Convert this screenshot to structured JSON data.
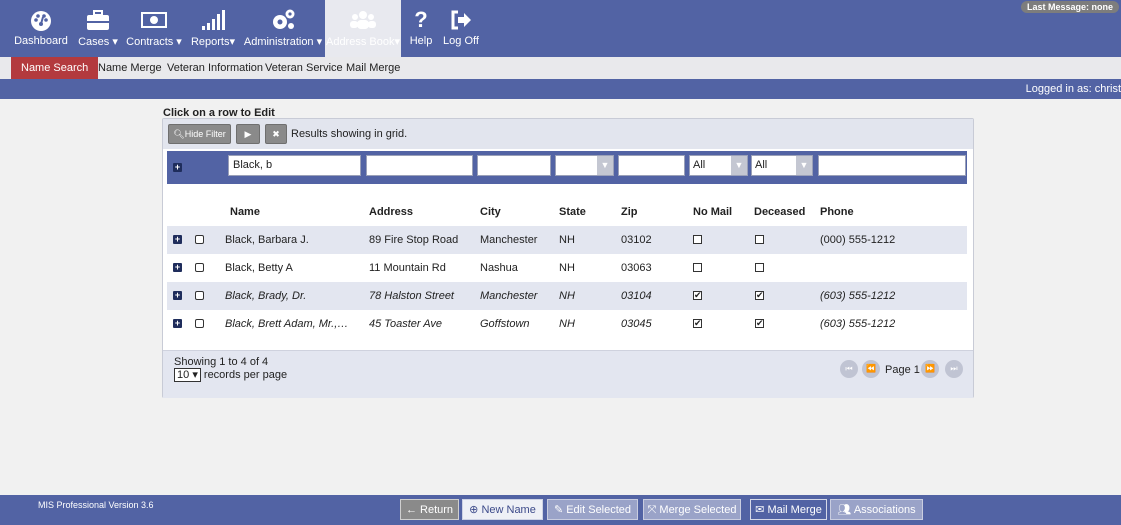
{
  "nav": {
    "items": [
      {
        "label": "Dashboard",
        "icon": "dashboard-icon"
      },
      {
        "label": "Cases",
        "icon": "briefcase-icon"
      },
      {
        "label": "Contracts",
        "icon": "money-icon"
      },
      {
        "label": "Reports",
        "icon": "bar-chart-icon"
      },
      {
        "label": "Administration",
        "icon": "gears-icon"
      },
      {
        "label": "Address Book",
        "icon": "users-icon"
      },
      {
        "label": "Help",
        "icon": "question-icon"
      },
      {
        "label": "Log Off",
        "icon": "logoff-icon"
      }
    ],
    "last_message": "Last Message: none"
  },
  "subnav": {
    "items": [
      "Name Search",
      "Name Merge",
      "Veteran Information",
      "Veteran Service",
      "Mail Merge"
    ]
  },
  "logged_in": "Logged in as: christ",
  "panel": {
    "click_label": "Click on a row to Edit",
    "hide_filter": "Hide Filter",
    "results_text": "Results showing in grid.",
    "filters": {
      "name": "Black, b",
      "no_mail": "All",
      "deceased": "All"
    },
    "columns": [
      "Name",
      "Address",
      "City",
      "State",
      "Zip",
      "No Mail",
      "Deceased",
      "Phone"
    ],
    "rows": [
      {
        "name": "Black, Barbara J.",
        "address": "89 Fire Stop Road",
        "city": "Manchester",
        "state": "NH",
        "zip": "03102",
        "no_mail": false,
        "deceased": false,
        "phone": "(000) 555-1212"
      },
      {
        "name": "Black, Betty A",
        "address": "11 Mountain Rd",
        "city": "Nashua",
        "state": "NH",
        "zip": "03063",
        "no_mail": false,
        "deceased": false,
        "phone": ""
      },
      {
        "name": "Black, Brady, Dr.",
        "address": "78 Halston Street",
        "city": "Manchester",
        "state": "NH",
        "zip": "03104",
        "no_mail": true,
        "deceased": true,
        "phone": "(603) 555-1212"
      },
      {
        "name": "Black, Brett Adam, Mr.,…",
        "address": "45 Toaster Ave",
        "city": "Goffstown",
        "state": "NH",
        "zip": "03045",
        "no_mail": true,
        "deceased": true,
        "phone": "(603) 555-1212"
      }
    ],
    "showing": "Showing 1 to 4 of 4",
    "per_page": "10",
    "per_page_label": "records per page",
    "page_label": "Page 1"
  },
  "footer": {
    "version": "MIS Professional Version 3.6",
    "buttons": {
      "return": "← Return",
      "new_name": "New Name",
      "edit_selected": "Edit Selected",
      "merge_selected": "Merge Selected",
      "mail_merge": "Mail Merge",
      "associations": "Associations"
    }
  }
}
